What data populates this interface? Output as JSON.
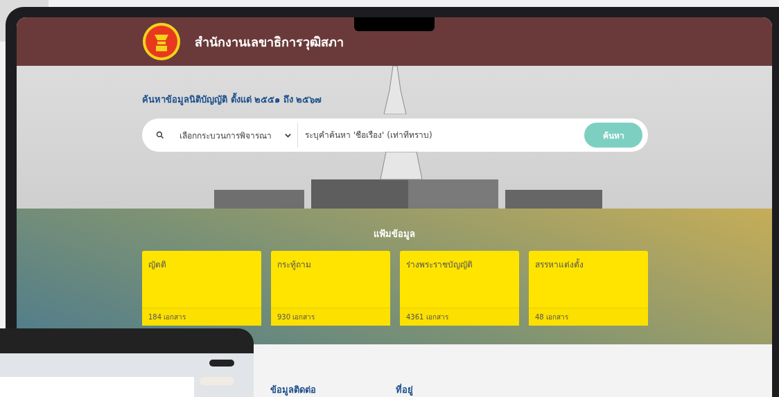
{
  "header": {
    "title": "สำนักงานเลขาธิการวุฒิสภา"
  },
  "search": {
    "heading": "ค้นหาข้อมูลนิติบัญญัติ ตั้งแต่ ๒๕๕๑ ถึง ๒๕๖๗",
    "process_select": "เลือกกระบวนการพิจารณา",
    "placeholder": "ระบุคำค้นหา 'ชื่อเรื่อง' (เท่าที่ทราบ)",
    "button": "ค้นหา"
  },
  "folders": {
    "heading": "แฟ้มข้อมูล",
    "items": [
      {
        "title": "ญัตติ",
        "count": "184 เอกสาร"
      },
      {
        "title": "กระทู้ถาม",
        "count": "930 เอกสาร"
      },
      {
        "title": "ร่างพระราชบัญญัติ",
        "count": "4361 เอกสาร"
      },
      {
        "title": "สรรหาแต่งตั้ง",
        "count": "48 เอกสาร"
      }
    ]
  },
  "footer": {
    "headings": [
      "ข้อมูลติดต่อ",
      "ที่อยู่"
    ]
  }
}
